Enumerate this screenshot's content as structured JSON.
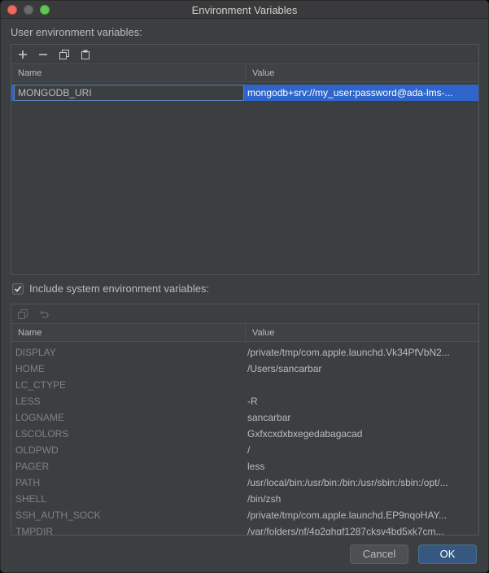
{
  "window": {
    "title": "Environment Variables"
  },
  "user_section": {
    "label": "User environment variables:",
    "toolbar": [
      "add-icon",
      "remove-icon",
      "copy-icon",
      "paste-icon"
    ],
    "columns": [
      "Name",
      "Value"
    ],
    "rows": [
      {
        "name": "MONGODB_URI",
        "value": "mongodb+srv://my_user:password@ada-lms-..."
      }
    ]
  },
  "include_system": {
    "label": "Include system environment variables:",
    "checked": true
  },
  "system_section": {
    "toolbar": [
      "copy-icon",
      "revert-icon"
    ],
    "columns": [
      "Name",
      "Value"
    ],
    "rows": [
      {
        "name": "DISPLAY",
        "value": "/private/tmp/com.apple.launchd.Vk34PfVbN2..."
      },
      {
        "name": "HOME",
        "value": "/Users/sancarbar"
      },
      {
        "name": "LC_CTYPE",
        "value": ""
      },
      {
        "name": "LESS",
        "value": "-R"
      },
      {
        "name": "LOGNAME",
        "value": "sancarbar"
      },
      {
        "name": "LSCOLORS",
        "value": "Gxfxcxdxbxegedabagacad"
      },
      {
        "name": "OLDPWD",
        "value": "/"
      },
      {
        "name": "PAGER",
        "value": "less"
      },
      {
        "name": "PATH",
        "value": "/usr/local/bin:/usr/bin:/bin:/usr/sbin:/sbin:/opt/..."
      },
      {
        "name": "SHELL",
        "value": "/bin/zsh"
      },
      {
        "name": "SSH_AUTH_SOCK",
        "value": "/private/tmp/com.apple.launchd.EP9nqoHAY..."
      },
      {
        "name": "TMPDIR",
        "value": "/var/folders/nf/4p2ghqf1287cksv4bd5xk7cm..."
      }
    ]
  },
  "buttons": {
    "cancel": "Cancel",
    "ok": "OK"
  },
  "colors": {
    "selection": "#2f65ca",
    "ok_button": "#365880",
    "background": "#3c3f41"
  }
}
